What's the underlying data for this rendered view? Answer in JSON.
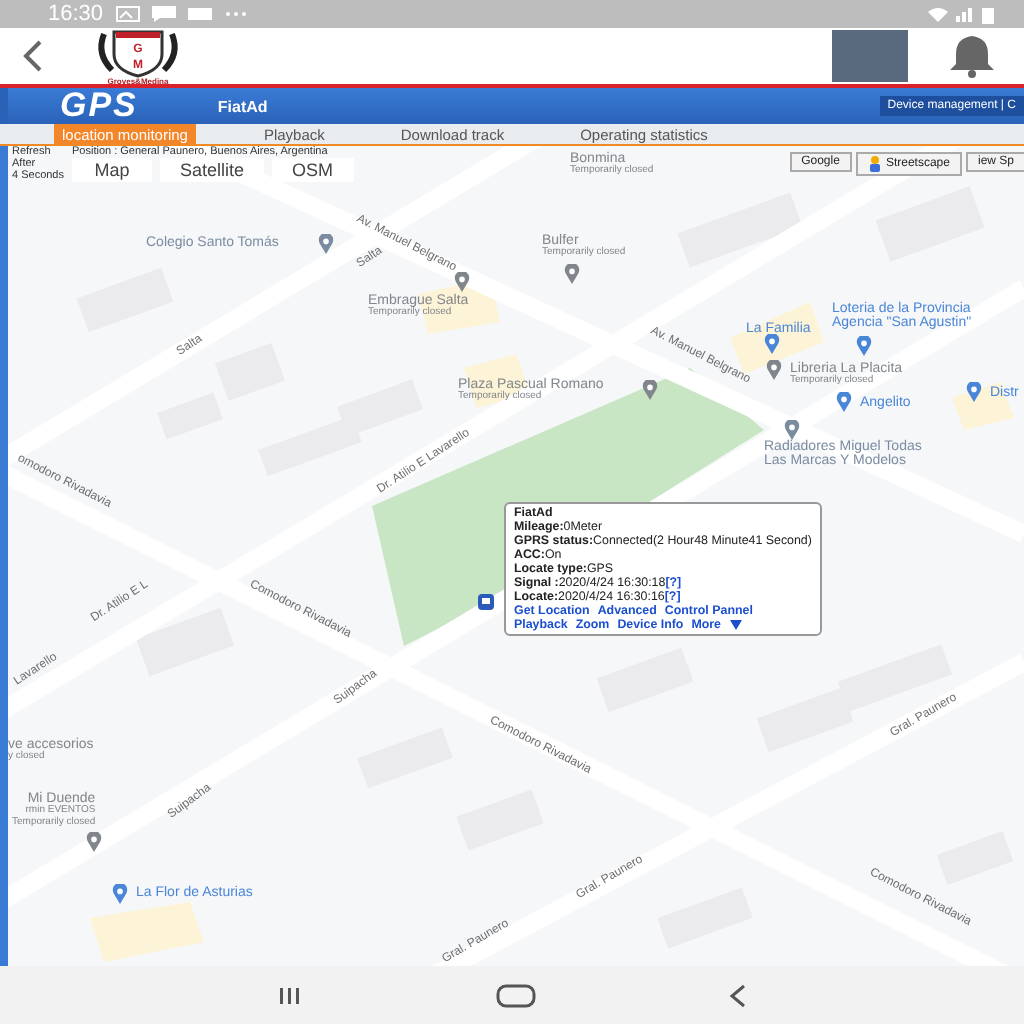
{
  "status_bar": {
    "time": "16:30"
  },
  "app_header": {
    "logo_text": [
      "G",
      "M",
      "Groves&Medina"
    ]
  },
  "gps_bar": {
    "logo": "GPS",
    "device": "FiatAd",
    "menu": "Device management | C"
  },
  "tabs": [
    {
      "label": "location monitoring",
      "selected": true
    },
    {
      "label": "Playback",
      "selected": false
    },
    {
      "label": "Download track",
      "selected": false
    },
    {
      "label": "Operating statistics",
      "selected": false
    }
  ],
  "toolbar": {
    "refresh": "Refresh",
    "after": "After",
    "seconds": "4 Seconds",
    "position": "Position : General Paunero, Buenos Aires, Argentina",
    "map_types": [
      "Map",
      "Satellite",
      "OSM"
    ],
    "google": "Google",
    "streetscape": "Streetscape",
    "view": "iew Sp"
  },
  "map": {
    "places": [
      {
        "lines": [
          "Bonmina",
          "Temporarily closed"
        ],
        "color": "#80868b"
      },
      {
        "lines": [
          "Colegio Santo Tomás"
        ],
        "color": "#7b8ba0"
      },
      {
        "lines": [
          "Embrague Salta",
          "Temporarily closed"
        ],
        "color": "#80868b"
      },
      {
        "lines": [
          "Bulfer",
          "Temporarily closed"
        ],
        "color": "#80868b"
      },
      {
        "lines": [
          "La Familia"
        ],
        "color": "#4a86d8"
      },
      {
        "lines": [
          "Loteria de la Provincia",
          "Agencia \"San Agustin\""
        ],
        "color": "#4a86d8"
      },
      {
        "lines": [
          "Libreria La Placita",
          "Temporarily closed"
        ],
        "color": "#80868b"
      },
      {
        "lines": [
          "Plaza Pascual Romano",
          "Temporarily closed"
        ],
        "color": "#80868b"
      },
      {
        "lines": [
          "Angelito"
        ],
        "color": "#4a86d8"
      },
      {
        "lines": [
          "Distr"
        ],
        "color": "#4a86d8"
      },
      {
        "lines": [
          "Radiadores Miguel Todas",
          "Las Marcas Y Modelos"
        ],
        "color": "#7b8ba0"
      },
      {
        "lines": [
          "ve accesorios",
          "y closed"
        ],
        "color": "#80868b"
      },
      {
        "lines": [
          "Mi Duende",
          "rmin EVENTOS",
          "Temporarily closed"
        ],
        "color": "#80868b"
      },
      {
        "lines": [
          "La Flor de Asturias"
        ],
        "color": "#4a86d8"
      }
    ],
    "streets": [
      "Av. Manuel Belgrano",
      "Av. Manuel Belgrano",
      "Salta",
      "Salta",
      "Dr. Atilio E Lavarello",
      "Dr. Atilio E L",
      "Lavarello",
      "omodoro Rivadavia",
      "Comodoro Rivadavia",
      "Comodoro Rivadavia",
      "Comodoro Rivadavia",
      "Suipacha",
      "Suipacha",
      "Gral. Paunero",
      "Gral. Paunero",
      "Gral. Paunero"
    ]
  },
  "popup": {
    "title": "FiatAd",
    "lines": [
      "**Mileage:**0Meter",
      "**GPRS status:**Connected(2 Hour48 Minute41 Second)",
      "**ACC:**On",
      "**Locate type:**GPS",
      "**Signal :**2020/4/24 16:30:18",
      "**Locate:**2020/4/24 16:30:16"
    ],
    "help": "[?]",
    "links": [
      [
        "Get Location",
        "Advanced",
        "Control Pannel"
      ],
      [
        "Playback",
        "Zoom",
        "Device Info",
        "More"
      ]
    ]
  }
}
